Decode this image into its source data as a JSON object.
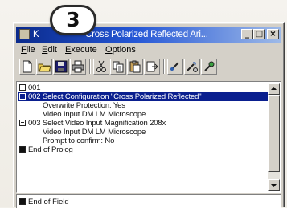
{
  "step_badge": "3",
  "window": {
    "title_prefix": "K",
    "title": "Cross Polarized Reflected Ari...",
    "controls": {
      "minimize": "_",
      "maximize": "□",
      "close": "×"
    }
  },
  "menu": {
    "items": [
      {
        "mnemonic": "F",
        "rest": "ile"
      },
      {
        "mnemonic": "E",
        "rest": "dit"
      },
      {
        "mnemonic": "E",
        "rest": "xecute"
      },
      {
        "mnemonic": "O",
        "rest": "ptions"
      }
    ]
  },
  "toolbar": {
    "icons": [
      "new-document-icon",
      "open-folder-icon",
      "save-disk-icon",
      "print-icon",
      "cut-icon",
      "copy-icon",
      "paste-icon",
      "insert-step-icon",
      "step-tool-icon",
      "run-tool-icon",
      "settings-tool-icon"
    ]
  },
  "steps": {
    "rows": [
      {
        "text": "001",
        "icon": "empty",
        "indent": false,
        "selected": false
      },
      {
        "text": "002  Select Configuration \"Cross Polarized Reflected\"",
        "icon": "minus",
        "indent": false,
        "selected": true
      },
      {
        "text": "Overwrite Protection: Yes",
        "icon": "none",
        "indent": true,
        "selected": false
      },
      {
        "text": "Video Input DM LM Microscope",
        "icon": "none",
        "indent": true,
        "selected": false
      },
      {
        "text": "003  Select Video Input Magnification 208x",
        "icon": "minus",
        "indent": false,
        "selected": false
      },
      {
        "text": "Video Input DM LM Microscope",
        "icon": "none",
        "indent": true,
        "selected": false
      },
      {
        "text": "Prompt to confirm: No",
        "icon": "none",
        "indent": true,
        "selected": false
      },
      {
        "text": "End of Prolog",
        "icon": "filled",
        "indent": false,
        "selected": false
      }
    ],
    "footer": "End of Field"
  }
}
